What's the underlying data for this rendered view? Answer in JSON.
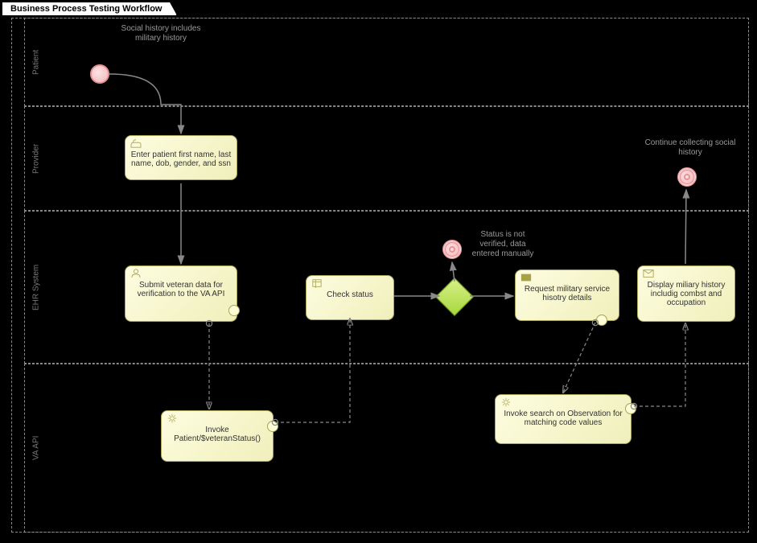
{
  "title": "Business Process Testing Workflow",
  "lanes": {
    "patient": "Patient",
    "provider": "Provider",
    "ehr": "EHR System",
    "va": "VA API"
  },
  "events": {
    "start_label": "Social history includes military history",
    "status_not_verified": "Status is not verified, data entered manually",
    "continue_social": "Continue collecting social history"
  },
  "tasks": {
    "enter_patient": "Enter patient first name, last name, dob, gender, and ssn",
    "submit_veteran": "Submit veteran data for verification to the VA API",
    "check_status": "Check status",
    "request_history": "Request military service hisotry details",
    "display_history": "Display miliary history includig combst and occupation",
    "invoke_patient": "Invoke Patient/$veteranStatus()",
    "invoke_search": "Invoke search on Observation for matching code values"
  },
  "chart_data": {
    "type": "bpmn",
    "pool": "Business Process Testing Workflow",
    "lanes": [
      "Patient",
      "Provider",
      "EHR System",
      "VA API"
    ],
    "nodes": [
      {
        "id": "start",
        "type": "startEvent",
        "lane": "Patient",
        "label": "Social history includes military history"
      },
      {
        "id": "t1",
        "type": "manualTask",
        "lane": "Provider",
        "label": "Enter patient first name, last name, dob, gender, and ssn"
      },
      {
        "id": "t2",
        "type": "userTask",
        "lane": "EHR System",
        "label": "Submit veteran data for verification to the VA API"
      },
      {
        "id": "t3",
        "type": "serviceTask",
        "lane": "VA API",
        "label": "Invoke Patient/$veteranStatus()"
      },
      {
        "id": "t4",
        "type": "scriptTask",
        "lane": "EHR System",
        "label": "Check status"
      },
      {
        "id": "g1",
        "type": "exclusiveGateway",
        "lane": "EHR System"
      },
      {
        "id": "e2",
        "type": "endEvent",
        "lane": "EHR System",
        "label": "Status is not verified, data entered manually"
      },
      {
        "id": "t5",
        "type": "sendTask",
        "lane": "EHR System",
        "label": "Request military service hisotry details"
      },
      {
        "id": "t6",
        "type": "serviceTask",
        "lane": "VA API",
        "label": "Invoke search on Observation for matching code values"
      },
      {
        "id": "t7",
        "type": "receiveTask",
        "lane": "EHR System",
        "label": "Display miliary history includig combst and occupation"
      },
      {
        "id": "end",
        "type": "endEvent",
        "lane": "Provider",
        "label": "Continue collecting social history"
      }
    ],
    "sequence_flows": [
      [
        "start",
        "t1"
      ],
      [
        "t1",
        "t2"
      ],
      [
        "t4",
        "g1"
      ],
      [
        "g1",
        "e2"
      ],
      [
        "g1",
        "t5"
      ],
      [
        "t7",
        "end"
      ]
    ],
    "message_flows": [
      [
        "t2",
        "t3"
      ],
      [
        "t3",
        "t4"
      ],
      [
        "t5",
        "t6"
      ],
      [
        "t6",
        "t7"
      ]
    ]
  }
}
